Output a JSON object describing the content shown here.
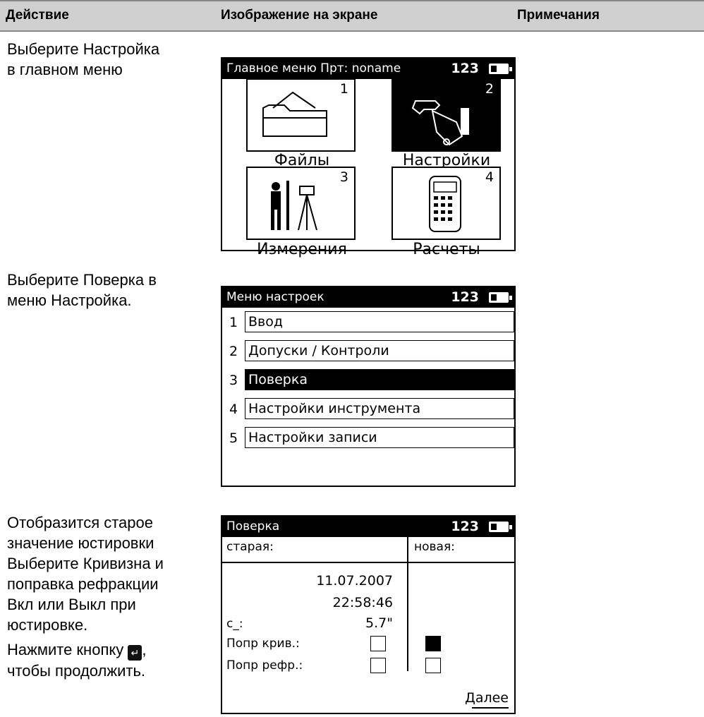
{
  "header": {
    "col1": "Действие",
    "col2": "Изображение на экране",
    "col3": "Примечания"
  },
  "steps": [
    {
      "line1": "Выберите Настройка",
      "line2": "в главном меню"
    },
    {
      "line1": "Выберите Поверка  в",
      "line2": "меню Настройка."
    },
    {
      "lines": [
        "Отобразится старое",
        "значение юстировки",
        "Выберите Кривизна и",
        "поправка рефракции",
        "Вкл или Выкл при",
        "юстировке."
      ],
      "press": "Нажмите кнопку",
      "key": "↵",
      "after_key": ",",
      "continue": "чтобы продолжить."
    }
  ],
  "screen1": {
    "title": "Главное меню  Прт: noname",
    "status": "123",
    "tiles": [
      {
        "num": "1",
        "label": "Файлы",
        "icon": "folder-icon",
        "selected": false
      },
      {
        "num": "2",
        "label": "Настройки",
        "icon": "wrench-hand-icon",
        "selected": true
      },
      {
        "num": "3",
        "label": "Измерения",
        "icon": "surveyor-tripod-icon",
        "selected": false
      },
      {
        "num": "4",
        "label": "Расчеты",
        "icon": "calculator-icon",
        "selected": false
      }
    ]
  },
  "screen2": {
    "title": "Меню настроек",
    "status": "123",
    "items": [
      {
        "num": "1",
        "label": "Ввод",
        "selected": false
      },
      {
        "num": "2",
        "label": "Допуски / Контроли",
        "selected": false
      },
      {
        "num": "3",
        "label": "Поверка",
        "selected": true
      },
      {
        "num": "4",
        "label": "Настройки инструмента",
        "selected": false
      },
      {
        "num": "5",
        "label": "Настройки записи",
        "selected": false
      }
    ]
  },
  "screen3": {
    "title": "Поверка",
    "status": "123",
    "col_old": "старая:",
    "col_new": "новая:",
    "date": "11.07.2007",
    "time": "22:58:46",
    "c_label": "c_:",
    "c_value": "5.7\"",
    "rows": [
      {
        "label": "Попр крив.:",
        "old": false,
        "new": true
      },
      {
        "label": "Попр рефр.:",
        "old": false,
        "new": false
      }
    ],
    "next": "Далее"
  }
}
